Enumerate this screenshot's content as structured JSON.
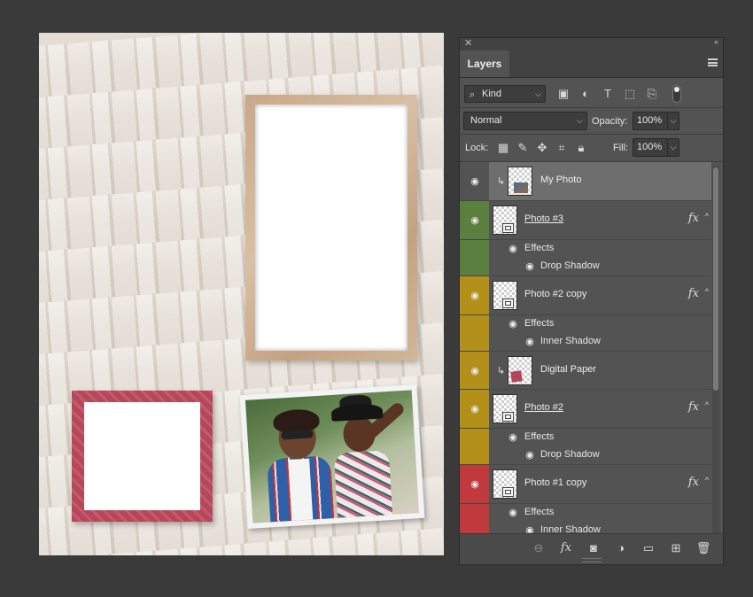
{
  "panel": {
    "tab_label": "Layers",
    "filter": {
      "kind_label": "Kind"
    },
    "blend": {
      "mode": "Normal",
      "opacity_label": "Opacity:",
      "opacity_value": "100%"
    },
    "lock": {
      "lock_label": "Lock:",
      "fill_label": "Fill:",
      "fill_value": "100%"
    }
  },
  "layers": [
    {
      "name": "My Photo",
      "selected": true
    },
    {
      "name": "Photo #3",
      "color": "#5b7f3f",
      "effects": [
        "Effects",
        "Drop Shadow"
      ]
    },
    {
      "name": "Photo #2 copy",
      "color": "#b39019",
      "effects": [
        "Effects",
        "Inner Shadow"
      ]
    },
    {
      "name": "Digital Paper",
      "color": "#b39019"
    },
    {
      "name": "Photo #2",
      "color": "#b39019",
      "effects": [
        "Effects",
        "Drop Shadow"
      ]
    },
    {
      "name": "Photo #1 copy",
      "color": "#c0393d",
      "effects": [
        "Effects",
        "Inner Shadow"
      ]
    }
  ],
  "fx_symbol": "fx"
}
